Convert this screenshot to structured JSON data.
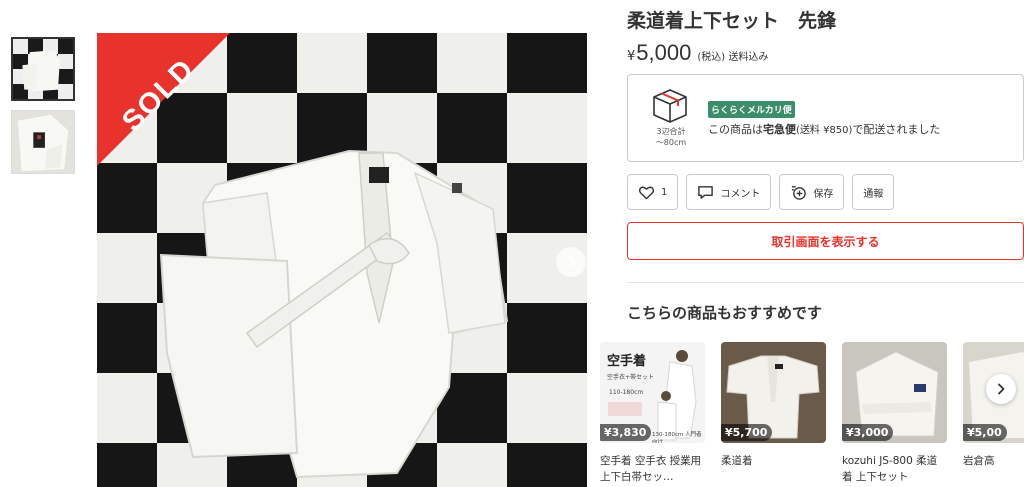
{
  "product": {
    "title": "柔道着上下セット　先鋒",
    "sold_label": "SOLD",
    "price": {
      "currency": "¥",
      "value": "5,000",
      "note": "(税込) 送料込み"
    }
  },
  "gallery": {
    "thumbnails": [
      "thumb-1",
      "thumb-2"
    ],
    "active_index": 0,
    "next_icon": "chevron-right-icon"
  },
  "shipping": {
    "box_icon": "package-box-icon",
    "size_line1": "3辺合計",
    "size_line2": "〜80cm",
    "method_badge": "らくらくメルカリ便",
    "text_prefix": "この商品は",
    "text_method": "宅急便",
    "text_fee": "(送料 ¥850)",
    "text_suffix": "で配送されました"
  },
  "actions": {
    "like_count": "1",
    "comment_label": "コメント",
    "save_label": "保存",
    "report_label": "通報"
  },
  "primary_button": "取引画面を表示する",
  "recommend": {
    "title": "こちらの商品もおすすめです",
    "items": [
      {
        "price": "¥3,830",
        "name": "空手着 空手衣 授業用 上下白帯セッ…"
      },
      {
        "price": "¥5,700",
        "name": "柔道着"
      },
      {
        "price": "¥3,000",
        "name": "kozuhi JS-800 柔道着 上下セット"
      },
      {
        "price": "¥5,00",
        "name": "岩倉高"
      }
    ],
    "item1_overlay": {
      "heading": "空手着",
      "sub": "空手衣+帯セット",
      "size": "110-180cm",
      "badge": "130-180cm 人門者向け"
    }
  },
  "colors": {
    "accent": "#e8332d",
    "badge_green": "#3c8e6b"
  }
}
